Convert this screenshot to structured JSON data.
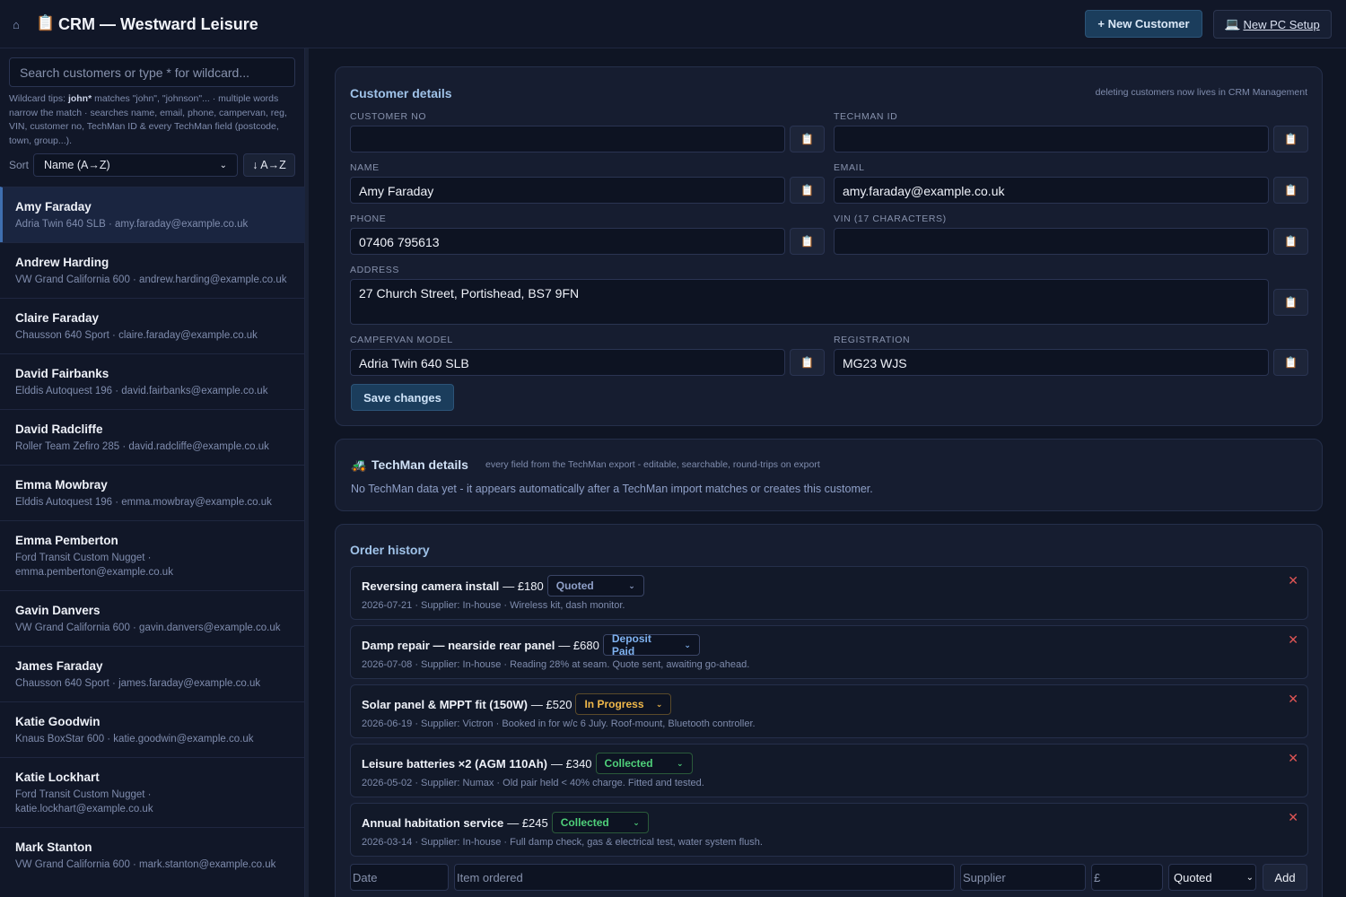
{
  "header": {
    "title": "CRM — Westward Leisure",
    "new_customer_label": "+ New Customer",
    "new_pc_setup_label": "New PC Setup"
  },
  "sidebar": {
    "search_placeholder": "Search customers or type * for wildcard...",
    "wildcard_tips_prefix": "Wildcard tips: ",
    "wildcard_tips_bold": "john*",
    "wildcard_tips_text": " matches \"john\", \"johnson\"... · multiple words narrow the match · searches name, email, phone, campervan, reg, VIN, customer no, TechMan ID & every TechMan field (postcode, town, group...).",
    "sort_label": "Sort",
    "sort_value": "Name (A→Z)",
    "sort_direction": "↓ A→Z",
    "customers": [
      {
        "name": "Amy Faraday",
        "meta": "Adria Twin 640 SLB · amy.faraday@example.co.uk"
      },
      {
        "name": "Andrew Harding",
        "meta": "VW Grand California 600 · andrew.harding@example.co.uk"
      },
      {
        "name": "Claire Faraday",
        "meta": "Chausson 640 Sport · claire.faraday@example.co.uk"
      },
      {
        "name": "David Fairbanks",
        "meta": "Elddis Autoquest 196 · david.fairbanks@example.co.uk"
      },
      {
        "name": "David Radcliffe",
        "meta": "Roller Team Zefiro 285 · david.radcliffe@example.co.uk"
      },
      {
        "name": "Emma Mowbray",
        "meta": "Elddis Autoquest 196 · emma.mowbray@example.co.uk"
      },
      {
        "name": "Emma Pemberton",
        "meta": "Ford Transit Custom Nugget · emma.pemberton@example.co.uk"
      },
      {
        "name": "Gavin Danvers",
        "meta": "VW Grand California 600 · gavin.danvers@example.co.uk"
      },
      {
        "name": "James Faraday",
        "meta": "Chausson 640 Sport · james.faraday@example.co.uk"
      },
      {
        "name": "Katie Goodwin",
        "meta": "Knaus BoxStar 600 · katie.goodwin@example.co.uk"
      },
      {
        "name": "Katie Lockhart",
        "meta": "Ford Transit Custom Nugget · katie.lockhart@example.co.uk"
      },
      {
        "name": "Mark Stanton",
        "meta": "VW Grand California 600 · mark.stanton@example.co.uk"
      }
    ]
  },
  "customer_details": {
    "title": "Customer details",
    "note": "deleting customers now lives in CRM Management",
    "fields": {
      "customer_no": {
        "label": "CUSTOMER NO",
        "value": ""
      },
      "techman_id": {
        "label": "TECHMAN ID",
        "value": ""
      },
      "name": {
        "label": "NAME",
        "value": "Amy Faraday"
      },
      "email": {
        "label": "EMAIL",
        "value": "amy.faraday@example.co.uk"
      },
      "phone": {
        "label": "PHONE",
        "value": "07406 795613"
      },
      "vin": {
        "label": "VIN (17 CHARACTERS)",
        "value": ""
      },
      "address": {
        "label": "ADDRESS",
        "value": "27 Church Street, Portishead, BS7 9FN"
      },
      "campervan_model": {
        "label": "CAMPERVAN MODEL",
        "value": "Adria Twin 640 SLB"
      },
      "registration": {
        "label": "REGISTRATION",
        "value": "MG23 WJS"
      }
    },
    "save_label": "Save changes"
  },
  "techman": {
    "title": "TechMan details",
    "note": "every field from the TechMan export - editable, searchable, round-trips on export",
    "empty_text": "No TechMan data yet - it appears automatically after a TechMan import matches or creates this customer."
  },
  "orders": {
    "title": "Order history",
    "items": [
      {
        "title": "Reversing camera install",
        "price": "— £180",
        "status": "Quoted",
        "status_color": "#8fa0c8",
        "sub": "2026-07-21 · Supplier: In-house · Wireless kit, dash monitor."
      },
      {
        "title": "Damp repair — nearside rear panel",
        "price": "— £680",
        "status": "Deposit Paid",
        "status_color": "#7fb2f0",
        "sub": "2026-07-08 · Supplier: In-house · Reading 28% at seam. Quote sent, awaiting go-ahead."
      },
      {
        "title": "Solar panel & MPPT fit (150W)",
        "price": "— £520",
        "status": "In Progress",
        "status_color": "#f0b84a",
        "sub": "2026-06-19 · Supplier: Victron · Booked in for w/c 6 July. Roof-mount, Bluetooth controller."
      },
      {
        "title": "Leisure batteries ×2 (AGM 110Ah)",
        "price": "— £340",
        "status": "Collected",
        "status_color": "#4fd07a",
        "sub": "2026-05-02 · Supplier: Numax · Old pair held < 40% charge. Fitted and tested."
      },
      {
        "title": "Annual habitation service",
        "price": "— £245",
        "status": "Collected",
        "status_color": "#4fd07a",
        "sub": "2026-03-14 · Supplier: In-house · Full damp check, gas & electrical test, water system flush."
      }
    ],
    "add_form": {
      "date_placeholder": "Date",
      "item_placeholder": "Item ordered",
      "supplier_placeholder": "Supplier",
      "price_placeholder": "£",
      "status_value": "Quoted",
      "add_label": "Add"
    }
  }
}
